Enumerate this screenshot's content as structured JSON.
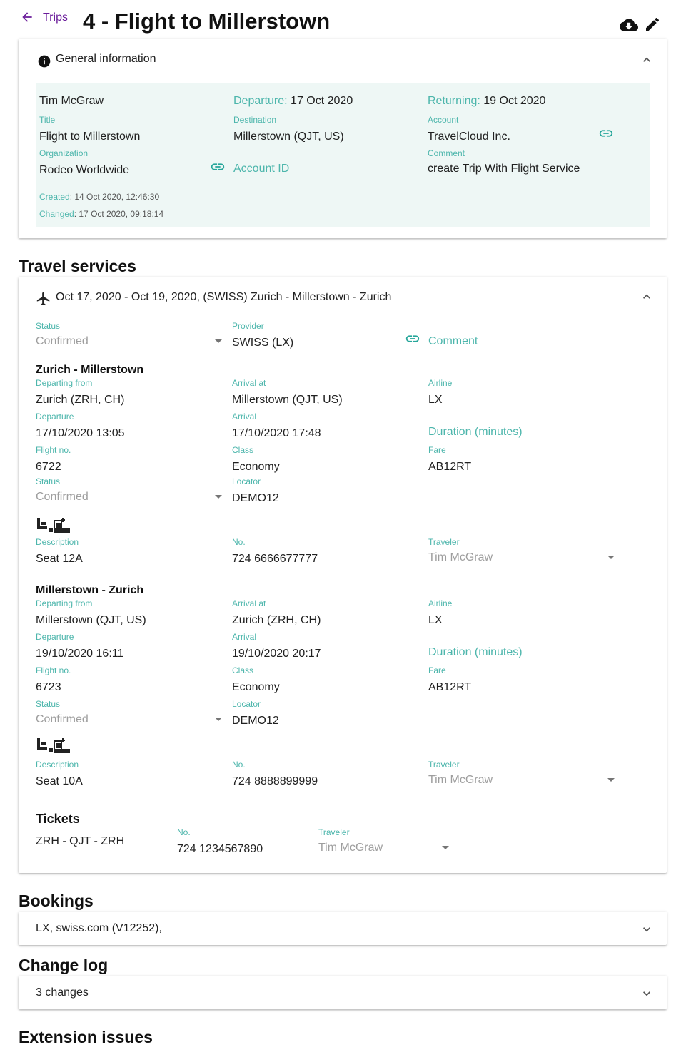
{
  "header": {
    "back_label": "Trips",
    "title": "4 - Flight to Millerstown"
  },
  "general": {
    "heading": "General information",
    "traveler": "Tim McGraw",
    "departure_label": "Departure:",
    "departure_value": "17 Oct 2020",
    "returning_label": "Returning:",
    "returning_value": "19 Oct 2020",
    "title_label": "Title",
    "title_value": "Flight to Millerstown",
    "destination_label": "Destination",
    "destination_value": "Millerstown (QJT, US)",
    "account_label": "Account",
    "account_value": "TravelCloud Inc.",
    "organization_label": "Organization",
    "organization_value": "Rodeo Worldwide",
    "account_id_label": "Account ID",
    "comment_label": "Comment",
    "comment_value": "create Trip With Flight Service",
    "created_label": "Created",
    "created_value": ": 14 Oct 2020, 12:46:30",
    "changed_label": "Changed",
    "changed_value": ": 17 Oct 2020, 09:18:14",
    "accent_color": "#4db6ac",
    "panel_bg": "#eef7f5"
  },
  "travel_services": {
    "heading": "Travel services",
    "service_header": "Oct 17, 2020 - Oct 19, 2020, (SWISS) Zurich - Millerstown - Zurich",
    "status_label": "Status",
    "status_value": "Confirmed",
    "provider_label": "Provider",
    "provider_value": "SWISS (LX)",
    "comment_label": "Comment",
    "segments": [
      {
        "title": "Zurich - Millerstown",
        "departing_from_label": "Departing from",
        "departing_from": "Zurich (ZRH, CH)",
        "arrival_at_label": "Arrival at",
        "arrival_at": "Millerstown (QJT, US)",
        "airline_label": "Airline",
        "airline": "LX",
        "departure_label": "Departure",
        "departure": "17/10/2020 13:05",
        "arrival_label": "Arrival",
        "arrival": "17/10/2020 17:48",
        "duration_label": "Duration (minutes)",
        "flight_no_label": "Flight no.",
        "flight_no": "6722",
        "class_label": "Class",
        "class": "Economy",
        "fare_label": "Fare",
        "fare": "AB12RT",
        "status_label": "Status",
        "status": "Confirmed",
        "locator_label": "Locator",
        "locator": "DEMO12",
        "description_label": "Description",
        "description": "Seat 12A",
        "no_label": "No.",
        "no": "724 6666677777",
        "traveler_label": "Traveler",
        "traveler": "Tim McGraw"
      },
      {
        "title": "Millerstown - Zurich",
        "departing_from_label": "Departing from",
        "departing_from": "Millerstown (QJT, US)",
        "arrival_at_label": "Arrival at",
        "arrival_at": "Zurich (ZRH, CH)",
        "airline_label": "Airline",
        "airline": "LX",
        "departure_label": "Departure",
        "departure": "19/10/2020 16:11",
        "arrival_label": "Arrival",
        "arrival": "19/10/2020 20:17",
        "duration_label": "Duration (minutes)",
        "flight_no_label": "Flight no.",
        "flight_no": "6723",
        "class_label": "Class",
        "class": "Economy",
        "fare_label": "Fare",
        "fare": "AB12RT",
        "status_label": "Status",
        "status": "Confirmed",
        "locator_label": "Locator",
        "locator": "DEMO12",
        "description_label": "Description",
        "description": "Seat 10A",
        "no_label": "No.",
        "no": "724 8888899999",
        "traveler_label": "Traveler",
        "traveler": "Tim McGraw"
      }
    ],
    "tickets": {
      "heading": "Tickets",
      "route": "ZRH - QJT - ZRH",
      "no_label": "No.",
      "no": "724 1234567890",
      "traveler_label": "Traveler",
      "traveler": "Tim McGraw"
    }
  },
  "bookings": {
    "heading": "Bookings",
    "summary": "LX, swiss.com (V12252),"
  },
  "change_log": {
    "heading": "Change log",
    "summary": "3 changes"
  },
  "extension_issues": {
    "heading": "Extension issues"
  },
  "icons": {
    "back": "arrow-left-icon",
    "download": "cloud-download-icon",
    "edit": "pencil-icon",
    "info": "info-icon",
    "collapse": "chevron-up-icon",
    "expand": "chevron-down-icon",
    "link": "link-icon",
    "flight": "airplane-icon",
    "seat": "seat-icon",
    "dropdown": "dropdown-arrow-icon"
  }
}
